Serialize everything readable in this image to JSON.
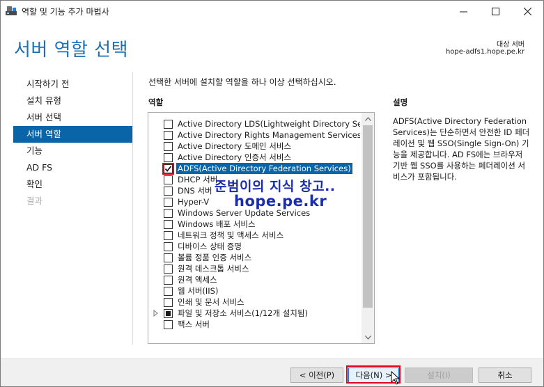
{
  "window": {
    "title": "역할 및 기능 추가 마법사"
  },
  "header": {
    "page_title": "서버 역할 선택",
    "target_label": "대상 서버",
    "target_server": "hope-adfs1.hope.pe.kr"
  },
  "nav": {
    "items": [
      {
        "label": "시작하기 전",
        "state": "normal"
      },
      {
        "label": "설치 유형",
        "state": "normal"
      },
      {
        "label": "서버 선택",
        "state": "normal"
      },
      {
        "label": "서버 역할",
        "state": "active"
      },
      {
        "label": "기능",
        "state": "normal"
      },
      {
        "label": "AD FS",
        "state": "normal"
      },
      {
        "label": "확인",
        "state": "normal"
      },
      {
        "label": "결과",
        "state": "disabled"
      }
    ]
  },
  "content": {
    "instruction": "선택한 서버에 설치할 역할을 하나 이상 선택하십시오.",
    "roles_header": "역할",
    "description_header": "설명",
    "description": "ADFS(Active Directory Federation Services)는 단순하면서 안전한 ID 페더레이션 및 웹 SSO(Single Sign-On) 기능을 제공합니다. AD FS에는 브라우저 기반 웹 SSO를 사용하는 페더레이션 서비스가 포함됩니다."
  },
  "roles": [
    {
      "label": "Active Directory LDS(Lightweight Directory Services)",
      "checked": false
    },
    {
      "label": "Active Directory Rights Management Services",
      "checked": false
    },
    {
      "label": "Active Directory 도메인 서비스",
      "checked": false
    },
    {
      "label": "Active Directory 인증서 서비스",
      "checked": false
    },
    {
      "label": "ADFS(Active Directory Federation Services)",
      "checked": true,
      "selected": true
    },
    {
      "label": "DHCP 서버",
      "checked": false
    },
    {
      "label": "DNS 서버",
      "checked": false
    },
    {
      "label": "Hyper-V",
      "checked": false
    },
    {
      "label": "Windows Server Update Services",
      "checked": false
    },
    {
      "label": "Windows 배포 서비스",
      "checked": false
    },
    {
      "label": "네트워크 정책 및 액세스 서비스",
      "checked": false
    },
    {
      "label": "디바이스 상태 증명",
      "checked": false
    },
    {
      "label": "볼륨 정품 인증 서비스",
      "checked": false
    },
    {
      "label": "원격 데스크톱 서비스",
      "checked": false
    },
    {
      "label": "원격 액세스",
      "checked": false
    },
    {
      "label": "웹 서버(IIS)",
      "checked": false
    },
    {
      "label": "인쇄 및 문서 서비스",
      "checked": false
    },
    {
      "label": "파일 및 저장소 서비스(1/12개 설치됨)",
      "checked": "partial",
      "expandable": true
    },
    {
      "label": "팩스 서버",
      "checked": false
    }
  ],
  "watermark": {
    "line1": "준범이의 지식 창고..",
    "line2": "hope.pe.kr"
  },
  "footer": {
    "prev_label": "< 이전(P)",
    "next_label": "다음(N) >",
    "install_label": "설치(I)",
    "cancel_label": "취소"
  },
  "colors": {
    "accent": "#0a64a8",
    "title_blue": "#1f6fb2",
    "highlight_red": "#e3001b",
    "watermark_blue": "#1a2cb0"
  }
}
